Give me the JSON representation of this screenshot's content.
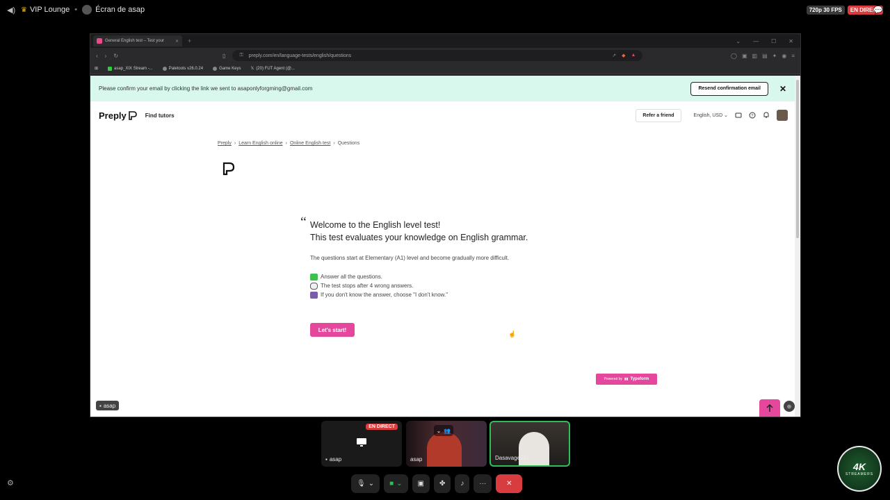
{
  "topbar": {
    "channel": "VIP Lounge",
    "screen_title": "Écran de asap",
    "quality": "720p 30 FPS",
    "live": "EN DIRECT"
  },
  "browser": {
    "tab_title": "General English test – Test your",
    "url": "preply.com/en/language-tests/english/questions",
    "bookmarks": [
      "asap_XIX Stream -...",
      "Paletools v26.0.24",
      "Game Keys",
      "(20) FUT Agent (@..."
    ]
  },
  "banner": {
    "text": "Please confirm your email by clicking the link we sent to asaponlyforgming@gmail.com",
    "resend_label": "Resend confirmation email"
  },
  "header": {
    "logo": "Preply",
    "find_tutors": "Find tutors",
    "refer_friend": "Refer a friend",
    "language": "English, USD"
  },
  "breadcrumb": [
    "Preply",
    "Learn English online",
    "Online English test",
    "Questions"
  ],
  "test": {
    "welcome_line1": "Welcome to the English level test!",
    "welcome_line2": "This test evaluates your knowledge on English grammar.",
    "subtitle": "The questions start at Elementary (A1) level and become gradually more difficult.",
    "rule1": "Answer all the questions.",
    "rule2": "The test stops after 4 wrong answers.",
    "rule3": "If you don't know the answer, choose \"I don't know.\"",
    "start_label": "Let's start!",
    "powered_prefix": "Powered by",
    "powered_brand": "Typeform"
  },
  "stream": {
    "streamer_label": "asap",
    "tiles": [
      {
        "name": "asap",
        "live": "EN DIRECT"
      },
      {
        "name": "asap"
      },
      {
        "name": "Dasavage001"
      }
    ]
  },
  "logo_badge": {
    "title": "4K",
    "sub": "STREAMERS"
  },
  "colors": {
    "accent": "#e4479c",
    "banner": "#d8f8ee",
    "live": "#d83c3e",
    "speaking": "#2fbf5a"
  }
}
